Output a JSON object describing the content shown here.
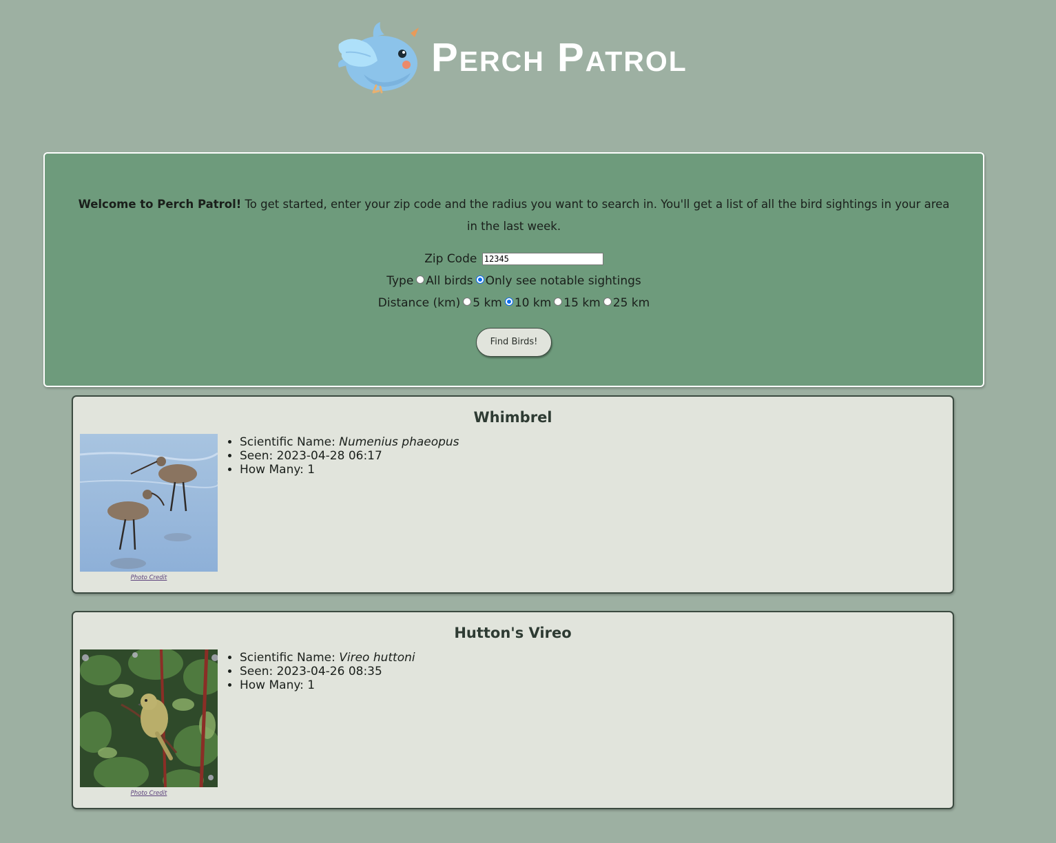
{
  "header": {
    "title": "Perch Patrol",
    "logo_icon": "bluebird-logo-icon",
    "colors": {
      "bird_body": "#8cc3ea",
      "bird_wing": "#aee0fa",
      "beak": "#e89a5a",
      "cheek": "#ec8a6a"
    }
  },
  "search": {
    "welcome_bold": "Welcome to Perch Patrol!",
    "welcome_text": " To get started, enter your zip code and the radius you want to search in. You'll get a list of all the bird sightings in your area in the last week.",
    "zip_label": "Zip Code",
    "zip_value": "12345",
    "type_label": "Type",
    "type_options": [
      "All birds",
      "Only see notable sightings"
    ],
    "type_selected": "Only see notable sightings",
    "distance_label": "Distance (km)",
    "distance_options": [
      "5 km",
      "10 km",
      "15 km",
      "25 km"
    ],
    "distance_selected": "10 km",
    "find_button": "Find Birds!"
  },
  "results": [
    {
      "name": "Whimbrel",
      "scientific_label": "Scientific Name: ",
      "scientific_name": "Numenius phaeopus",
      "seen_text": "Seen: 2023-04-28 06:17",
      "how_many_text": "How Many: 1",
      "photo_credit": "Photo Credit",
      "photo_icon": "whimbrel-photo"
    },
    {
      "name": "Hutton's Vireo",
      "scientific_label": "Scientific Name: ",
      "scientific_name": "Vireo huttoni",
      "seen_text": "Seen: 2023-04-26 08:35",
      "how_many_text": "How Many: 1",
      "photo_credit": "Photo Credit",
      "photo_icon": "vireo-photo"
    }
  ],
  "colors": {
    "page_bg": "#9db0a2",
    "panel_bg": "#6e9b7c",
    "card_bg": "#e1e4dc",
    "card_border": "#3b4a40",
    "radio_checked": "#0a6cf0"
  }
}
